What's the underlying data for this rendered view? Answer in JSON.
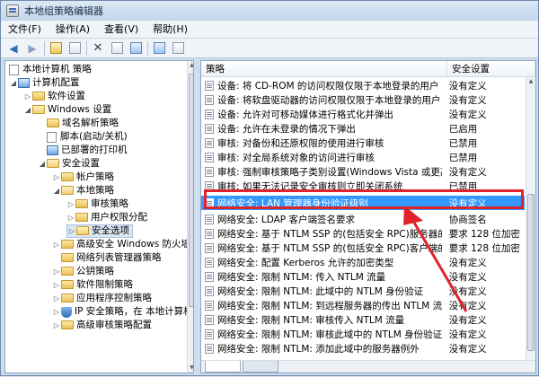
{
  "window": {
    "title": "本地组策略编辑器"
  },
  "menu": [
    "文件(F)",
    "操作(A)",
    "查看(V)",
    "帮助(H)"
  ],
  "toolbar_icons": [
    "back-icon",
    "forward-icon",
    "up-folder-icon",
    "show-tree-icon",
    "delete-icon",
    "properties-icon",
    "export-icon",
    "help-icon",
    "filter-icon"
  ],
  "tree": [
    "本地计算机 策略",
    "计算机配置",
    "软件设置",
    "Windows 设置",
    "域名解析策略",
    "脚本(启动/关机)",
    "已部署的打印机",
    "安全设置",
    "帐户策略",
    "本地策略",
    "审核策略",
    "用户权限分配",
    "安全选项",
    "高级安全 Windows 防火墙",
    "网络列表管理器策略",
    "公钥策略",
    "软件限制策略",
    "应用程序控制策略",
    "IP 安全策略，在 本地计算机",
    "高级审核策略配置"
  ],
  "table": {
    "columns": [
      "策略",
      "安全设置"
    ],
    "rows": [
      {
        "policy": "设备: 将 CD-ROM 的访问权限仅限于本地登录的用户",
        "setting": "没有定义"
      },
      {
        "policy": "设备: 将软盘驱动器的访问权限仅限于本地登录的用户",
        "setting": "没有定义"
      },
      {
        "policy": "设备: 允许对可移动媒体进行格式化并弹出",
        "setting": "没有定义"
      },
      {
        "policy": "设备: 允许在未登录的情况下弹出",
        "setting": "已启用"
      },
      {
        "policy": "审核: 对备份和还原权限的使用进行审核",
        "setting": "已禁用"
      },
      {
        "policy": "审核: 对全局系统对象的访问进行审核",
        "setting": "已禁用"
      },
      {
        "policy": "审核: 强制审核策略子类别设置(Windows Vista 或更高版本...",
        "setting": "没有定义"
      },
      {
        "policy": "审核: 如果无法记录安全审核则立即关闭系统",
        "setting": "已禁用"
      },
      {
        "policy": "网络安全: LAN 管理器身份验证级别",
        "setting": "没有定义"
      },
      {
        "policy": "网络安全: LDAP 客户端签名要求",
        "setting": "协商签名"
      },
      {
        "policy": "网络安全: 基于 NTLM SSP 的(包括安全 RPC)服务器的最小...",
        "setting": "要求 128 位加密"
      },
      {
        "policy": "网络安全: 基于 NTLM SSP 的(包括安全 RPC)客户端的最小...",
        "setting": "要求 128 位加密"
      },
      {
        "policy": "网络安全: 配置 Kerberos 允许的加密类型",
        "setting": "没有定义"
      },
      {
        "policy": "网络安全: 限制 NTLM: 传入 NTLM 流量",
        "setting": "没有定义"
      },
      {
        "policy": "网络安全: 限制 NTLM: 此域中的 NTLM 身份验证",
        "setting": "没有定义"
      },
      {
        "policy": "网络安全: 限制 NTLM: 到远程服务器的传出 NTLM 流量",
        "setting": "没有定义"
      },
      {
        "policy": "网络安全: 限制 NTLM: 审核传入 NTLM 流量",
        "setting": "没有定义"
      },
      {
        "policy": "网络安全: 限制 NTLM: 审核此域中的 NTLM 身份验证",
        "setting": "没有定义"
      },
      {
        "policy": "网络安全: 限制 NTLM: 添加此域中的服务器例外",
        "setting": "没有定义"
      }
    ]
  },
  "colors": {
    "selection": "#3399ff",
    "highlight_box": "#e0232b",
    "arrow": "#e0232b"
  }
}
